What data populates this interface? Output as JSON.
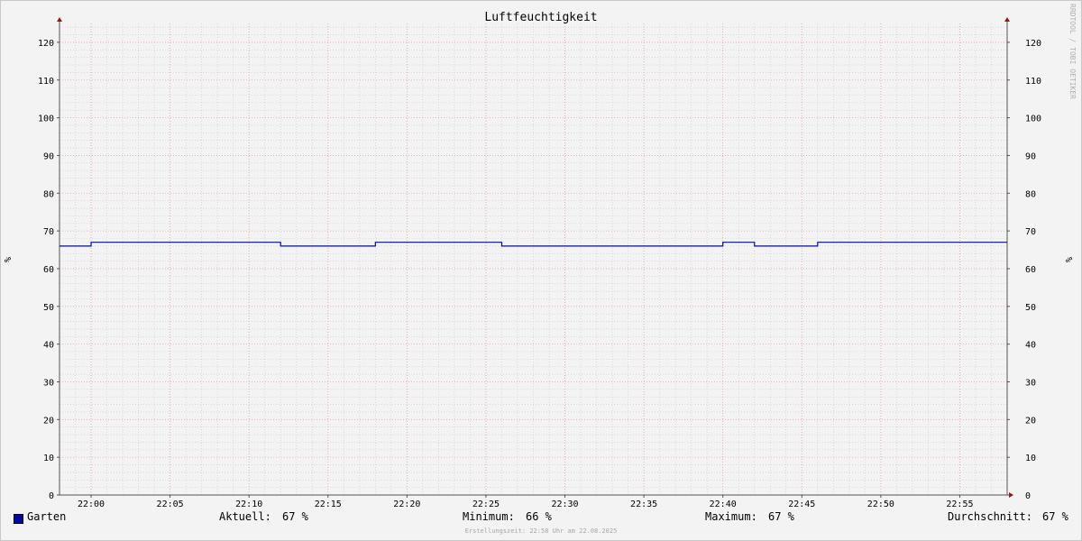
{
  "chart_data": {
    "type": "line",
    "title": "Luftfeuchtigkeit",
    "ylabel_left": "%",
    "ylabel_right": "%",
    "ylim": [
      0,
      125
    ],
    "y_ticks": [
      0,
      10,
      20,
      30,
      40,
      50,
      60,
      70,
      80,
      90,
      100,
      110,
      120
    ],
    "x_range": [
      "21:58",
      "22:58"
    ],
    "x_ticks": [
      "22:00",
      "22:05",
      "22:10",
      "22:15",
      "22:20",
      "22:25",
      "22:30",
      "22:35",
      "22:40",
      "22:45",
      "22:50",
      "22:55"
    ],
    "grid": true,
    "series": [
      {
        "name": "Garten",
        "color": "#000aa0",
        "step": true,
        "points": [
          [
            "21:58",
            66
          ],
          [
            "22:00",
            67
          ],
          [
            "22:12",
            66
          ],
          [
            "22:18",
            67
          ],
          [
            "22:26",
            66
          ],
          [
            "22:40",
            67
          ],
          [
            "22:42",
            66
          ],
          [
            "22:46",
            67
          ],
          [
            "22:58",
            67
          ]
        ]
      }
    ]
  },
  "legend": {
    "series_name": "Garten",
    "current_label": "Aktuell:",
    "current_value": "67 %",
    "min_label": "Minimum:",
    "min_value": "66 %",
    "max_label": "Maximum:",
    "max_value": "67 %",
    "avg_label": "Durchschnitt:",
    "avg_value": "67 %"
  },
  "footer": "Erstellungszeit: 22:58 Uhr am 22.08.2025",
  "watermark": "RRDTOOL / TOBI OETIKER"
}
